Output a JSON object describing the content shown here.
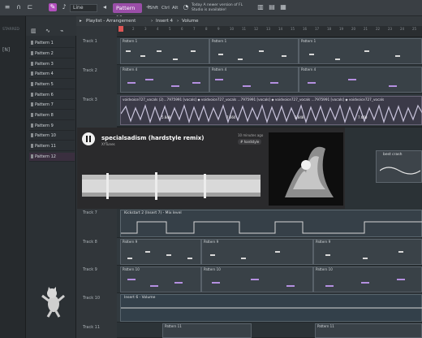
{
  "toolbar": {
    "mode": "Line",
    "pattern": "Pattern 12",
    "shift": "Shft",
    "ctrl": "Ctrl",
    "alt": "Alt",
    "info": "Today   A newer version of FL Studio is available!"
  },
  "browser": {
    "label1": "STARRED",
    "label2": "[N]"
  },
  "picker": {
    "patterns": [
      "Pattern 1",
      "Pattern 2",
      "Pattern 3",
      "Pattern 4",
      "Pattern 5",
      "Pattern 6",
      "Pattern 7",
      "Pattern 8",
      "Pattern 9",
      "Pattern 10",
      "Pattern 11",
      "Pattern 12"
    ]
  },
  "playlist": {
    "title": "Playlist - Arrangement",
    "insert": "Insert 4",
    "param": "Volume",
    "ruler": [
      "1",
      "2",
      "3",
      "4",
      "5",
      "6",
      "7",
      "8",
      "9",
      "10",
      "11",
      "12",
      "13",
      "14",
      "15",
      "16",
      "17",
      "18",
      "19",
      "20",
      "21",
      "22",
      "23",
      "24",
      "25"
    ]
  },
  "tracks": [
    {
      "name": "Track 1"
    },
    {
      "name": "Track 2"
    },
    {
      "name": "Track 3"
    },
    {
      "name": "Track 7"
    },
    {
      "name": "Track 8"
    },
    {
      "name": "Track 9"
    },
    {
      "name": "Track 10"
    },
    {
      "name": "Track 11"
    }
  ],
  "clips": {
    "pattern1": "Pattern 1",
    "pattern4": "Pattern 4",
    "pattern9": "Pattern 9",
    "pattern10": "Pattern 10",
    "pattern11": "Pattern 11",
    "audio": "voidvoice727_vocals (2)...7975991 [vocals] ◆ voidvoice727_vocals ...7975991 [vocals] ◆ voidvoice727_vocals ...7975991 [vocals] ◆ voidvoice727_vocals",
    "mix": "Kickstart 2 (Insert 7) - Mix level",
    "insert": "Insert 6 - Volume",
    "crash": "best crash"
  },
  "player": {
    "title": "specialsadism (hardstyle remix)",
    "artist": "XYTunes",
    "posted": "10 minutes ago",
    "tag": "# hardstyle"
  },
  "audio_labels": [
    "5.848",
    "7.660",
    "5.848",
    "7.660"
  ]
}
